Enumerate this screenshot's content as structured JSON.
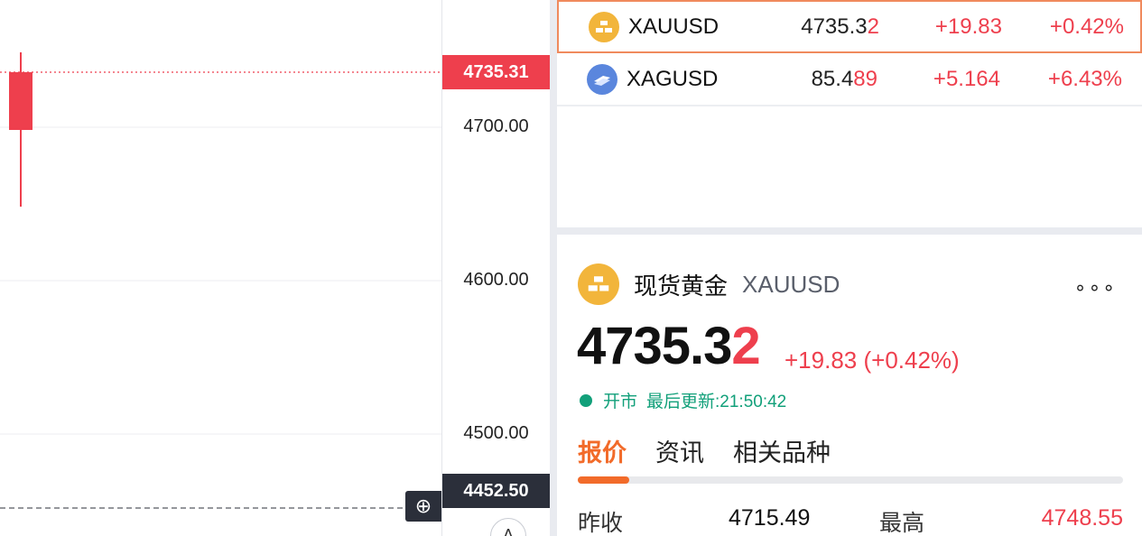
{
  "chart": {
    "price_ticks": [
      "4700.00",
      "4600.00",
      "4500.00"
    ],
    "last_price_tag": "4735.31",
    "crosshair_price_tag": "4452.50",
    "a_button": "A",
    "candle": {
      "open": 4715.49,
      "close": 4735.31,
      "high": 4748.55,
      "low": 4652.0
    },
    "colors": {
      "up": "#ee3f4d",
      "crosshair": "#2b2f3a"
    }
  },
  "watchlist": [
    {
      "symbol": "XAUUSD",
      "price_main": "4735.3",
      "price_last": "2",
      "change": "+19.83",
      "pct": "+0.42%",
      "icon": "gold-bar-icon",
      "selected": true
    },
    {
      "symbol": "XAGUSD",
      "price_main": "85.4",
      "price_last": "89",
      "change": "+5.164",
      "pct": "+6.43%",
      "icon": "silver-bar-icon",
      "selected": false
    }
  ],
  "detail": {
    "name": "现货黄金",
    "symbol": "XAUUSD",
    "price_main": "4735.3",
    "price_last": "2",
    "change": "+19.83 (+0.42%)",
    "status": "开市",
    "updated": "最后更新:21:50:42",
    "tabs": [
      "报价",
      "资讯",
      "相关品种"
    ],
    "stats": {
      "prev_close_label": "昨收",
      "prev_close": "4715.49",
      "high_label": "最高",
      "high": "4748.55"
    }
  },
  "colors": {
    "up": "#ee3f4d",
    "accent": "#f26b2a",
    "open_status": "#12a07a",
    "gold": "#f2b53b",
    "silver": "#5a86dd"
  }
}
